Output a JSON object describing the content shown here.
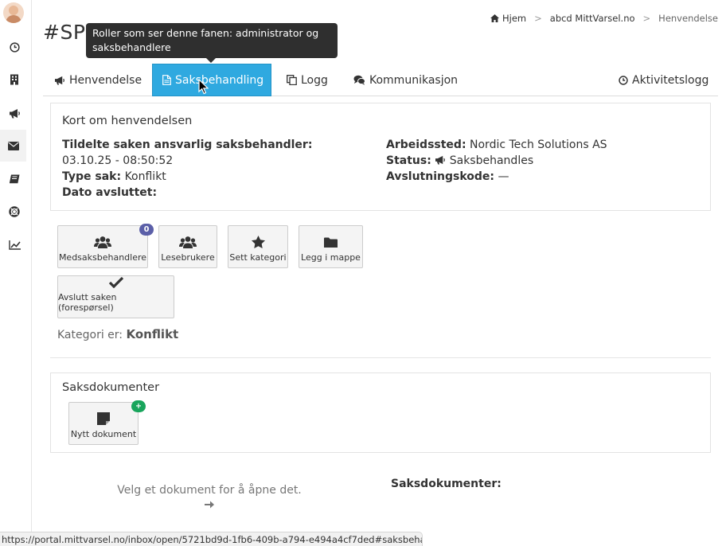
{
  "page": {
    "title": "#SPW"
  },
  "breadcrumb": {
    "home": "Hjem",
    "tenant": "abcd MittVarsel.no",
    "current": "Henvendelse"
  },
  "tooltip": {
    "text": "Roller som ser denne fanen: administrator og saksbehandlere"
  },
  "tabs": [
    {
      "label": "Henvendelse",
      "icon": "megaphone-icon"
    },
    {
      "label": "Saksbehandling",
      "icon": "file-icon",
      "active": true
    },
    {
      "label": "Logg",
      "icon": "copy-icon"
    },
    {
      "label": "Kommunikasjon",
      "icon": "chat-icon"
    },
    {
      "label": "Aktivitetslogg",
      "icon": "clock-icon"
    }
  ],
  "summary": {
    "title": "Kort om henvendelsen",
    "assigned_label": "Tildelte saken ansvarlig saksbehandler:",
    "assigned_value": "03.10.25 - 08:50:52",
    "type_label": "Type sak:",
    "type_value": "Konflikt",
    "closed_label": "Dato avsluttet:",
    "closed_value": "",
    "workplace_label": "Arbeidssted:",
    "workplace_value": "Nordic Tech Solutions AS",
    "status_label": "Status:",
    "status_value": "Saksbehandles",
    "closing_code_label": "Avslutningskode:",
    "closing_code_value": "—"
  },
  "actions": {
    "co_handlers": {
      "label": "Medsaksbehandlere",
      "badge": "0"
    },
    "readers": {
      "label": "Lesebrukere"
    },
    "set_category": {
      "label": "Sett kategori"
    },
    "folder": {
      "label": "Legg i mappe"
    },
    "close_case": {
      "label": "Avslutt saken (forespørsel)"
    }
  },
  "category": {
    "prefix": "Kategori er:",
    "value": "Konflikt"
  },
  "documents": {
    "title": "Saksdokumenter",
    "new_doc_label": "Nytt dokument",
    "new_doc_badge": "+",
    "empty_hint": "Velg et dokument for å åpne det.",
    "list_label": "Saksdokumenter:"
  },
  "statusbar": {
    "url": "https://portal.mittvarsel.no/inbox/open/5721bd9d-1fb6-409b-a794-e494a4cf7ded#saksbehandling"
  },
  "colors": {
    "accent": "#2fa9e0",
    "badge_blue": "#5b5fa8",
    "badge_green": "#19a55c",
    "tooltip_bg": "#2f2f2f"
  }
}
